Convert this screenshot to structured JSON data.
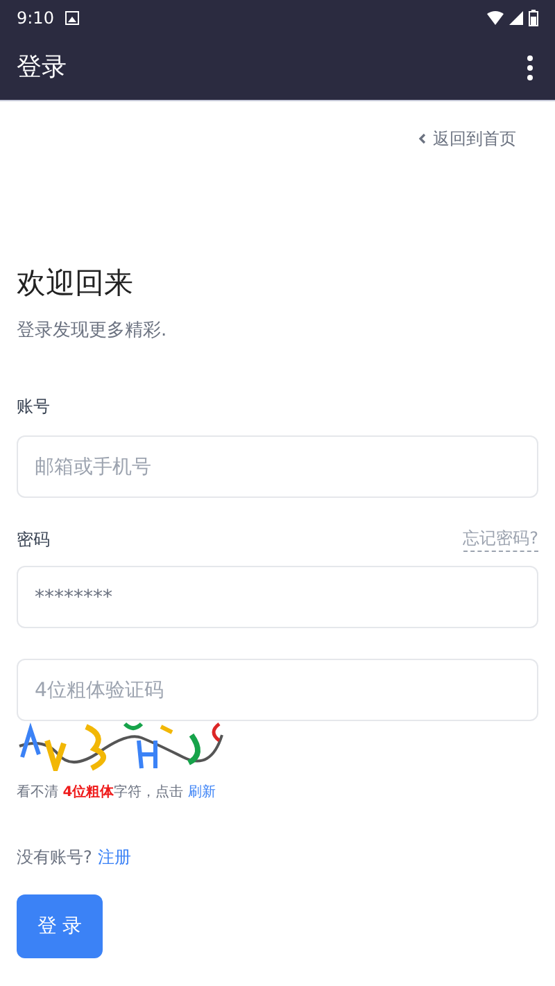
{
  "status_bar": {
    "time": "9:10"
  },
  "app_bar": {
    "title": "登录"
  },
  "back_link": "返回到首页",
  "heading": "欢迎回来",
  "subtitle": "登录发现更多精彩.",
  "account": {
    "label": "账号",
    "placeholder": "邮箱或手机号"
  },
  "password": {
    "label": "密码",
    "forgot_link": "忘记密码?",
    "value": "********"
  },
  "captcha": {
    "placeholder": "4位粗体验证码",
    "hint_prefix": "看不清 ",
    "hint_emphasis": "4位粗体",
    "hint_suffix": "字符，点击 ",
    "refresh_link": "刷新"
  },
  "signup": {
    "prompt": "没有账号?",
    "link": "注册"
  },
  "login_button": "登 录"
}
